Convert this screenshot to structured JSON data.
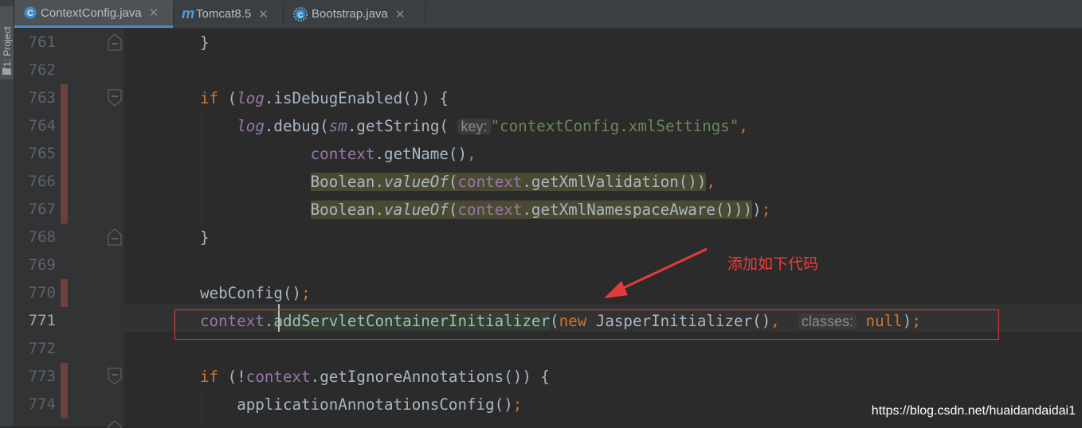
{
  "tool_window": {
    "project_label": "1: Project"
  },
  "tabs": [
    {
      "label": "ContextConfig.java",
      "icon": "class-icon",
      "active": true
    },
    {
      "label": "Tomcat8.5",
      "icon": "maven-icon",
      "active": false
    },
    {
      "label": "Bootstrap.java",
      "icon": "class-gear-icon",
      "active": false
    }
  ],
  "editor": {
    "line_numbers": [
      "761",
      "762",
      "763",
      "764",
      "765",
      "766",
      "767",
      "768",
      "769",
      "770",
      "771",
      "772",
      "773",
      "774"
    ],
    "current_line": "771",
    "hints": {
      "key": "key:",
      "classes": "classes:"
    }
  },
  "annotation": {
    "text": "添加如下代码"
  },
  "watermark": {
    "text": "https://blog.csdn.net/huaidandaidai1"
  },
  "colors": {
    "background": "#2b2b2b",
    "keyword": "#cc7832",
    "field": "#9876aa",
    "string": "#6a8759",
    "annotation": "#f03c3c",
    "selection_box": "#e23b3b"
  }
}
